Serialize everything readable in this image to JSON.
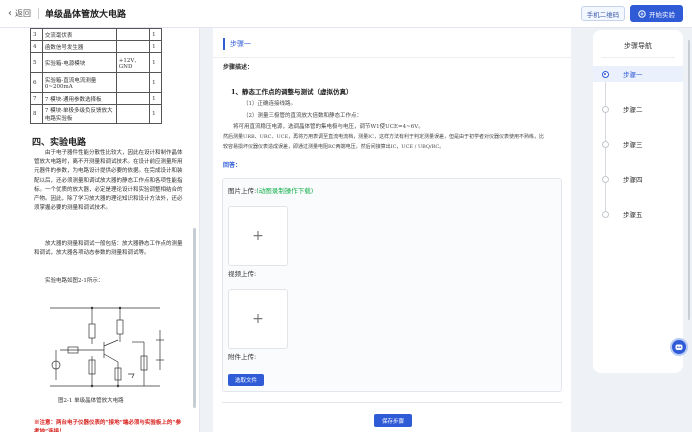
{
  "header": {
    "back_label": "返回",
    "title": "单级晶体管放大电路",
    "qr_label": "手机二维码",
    "start_label": "开始实验"
  },
  "document": {
    "table_rows": [
      {
        "no": "3",
        "name": "交流毫伏表",
        "spec": "",
        "qty": "1"
      },
      {
        "no": "4",
        "name": "函数信号发生器",
        "spec": "",
        "qty": "1"
      },
      {
        "no": "5",
        "name": "实验箱-电源模块",
        "spec": "+12V、GND",
        "qty": "1"
      },
      {
        "no": "6",
        "name": "实验箱-直流电流测量 0~200mA",
        "spec": "",
        "qty": "1"
      },
      {
        "no": "7",
        "name": "7 模块-通用参数选择板",
        "spec": "",
        "qty": "1"
      },
      {
        "no": "8",
        "name": "7 模块-单极多级负反馈放大电路实验板",
        "spec": "",
        "qty": "1"
      }
    ],
    "section_title": "四、实验电路",
    "para1": "由于电子器件性能分散性比较大，因此在设计和制作晶体管放大电路时，离不开测量和调试技术。在设计前应测量所用元器件的参数，为电路设计提供必要的依据。在完成设计和装配以后，还必须测量和调试放大器的静态工作点和各项性能指标。一个优质的放大器，必定是理论设计和实验调整相结合的产物。因此，除了学习放大器的理论知识和设计方法外，还必须掌握必要的测量和调试技术。",
    "para2": "放大器的测量和调试一般包括：放大器静态工作点的测量和调试，放大器各项动态参数的测量和调试等。",
    "para3": "实验电路如图2-1所示：",
    "figure_caption": "图2-1  单级晶体管放大电路",
    "note": "※注意：两台电子仪器仪表的“接地”端必须与实验板上的“参考地”连接！"
  },
  "step": {
    "title": "步骤一",
    "desc_label": "步骤描述：",
    "heading": "1、静态工作点的调整与测试（虚拟仿真）",
    "line1": "（1）正确连接线路。",
    "line2": "（2）测量三极管的直流放大倍数和静态工作点：",
    "line3": "将可用直流稳压电源，选调晶体管的集电极与电压，调节W1使UCE=4~6V。",
    "line4": "然后测量URB、URC、UCE，再将万用表调至直流电流档，测量IC，这样方法有利于判定测量误差，但是由于初学者对仪器仪表使用不熟练，比",
    "line5": "较容易损坏仪器仪表造成误差，即通过测量电阻RC两端电压，然后间接算出IC，UCE / UBQ/RC。",
    "answer_label": "回答：",
    "image_label": "图片上传:",
    "image_hint": "(动图录制操作下载)",
    "video_label": "视频上传:",
    "attach_label": "附件上传:",
    "choose_label": "选取文件",
    "save_label": "保存步骤"
  },
  "nav": {
    "title": "步骤导航",
    "items": [
      "步骤一",
      "步骤二",
      "步骤三",
      "步骤四",
      "步骤五"
    ],
    "active_index": 0
  },
  "icons": {
    "back": "chevron-left-icon",
    "start": "experiment-icon",
    "upload": "plus-icon",
    "assistant": "robot-assistant-icon"
  },
  "colors": {
    "primary": "#2f5bd7",
    "note": "#d8231f",
    "hint": "#16b14e"
  }
}
